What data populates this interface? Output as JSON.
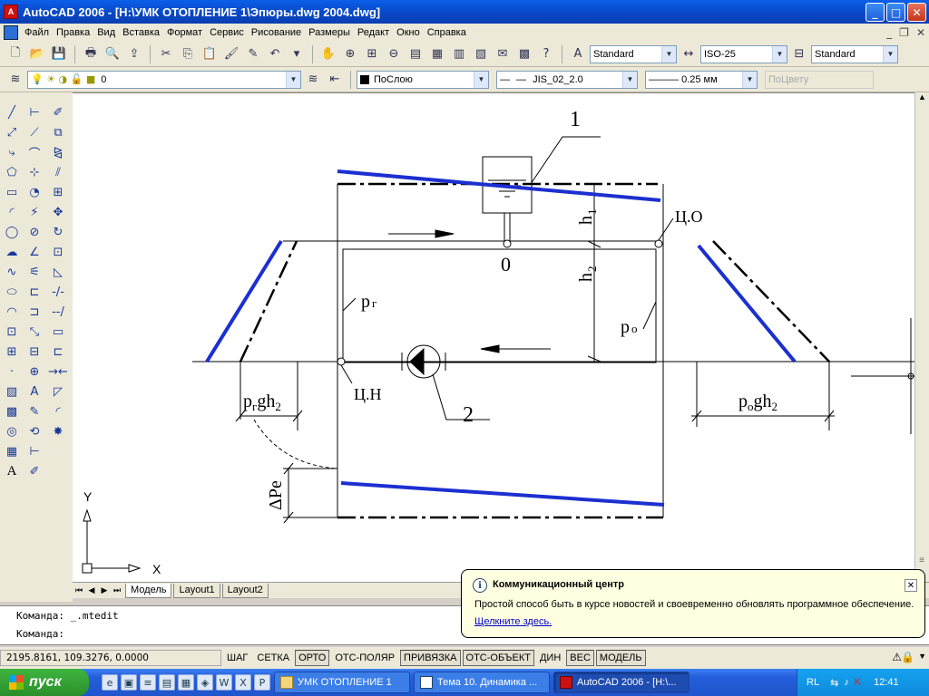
{
  "window": {
    "title": "AutoCAD 2006 - [H:\\УМК ОТОПЛЕНИЕ 1\\Эпюры.dwg 2004.dwg]",
    "min": "_",
    "max": "□",
    "close": "✕"
  },
  "menu": [
    "Файл",
    "Правка",
    "Вид",
    "Вставка",
    "Формат",
    "Сервис",
    "Рисование",
    "Размеры",
    "Редакт",
    "Окно",
    "Справка"
  ],
  "toolbar1": {
    "text_style": "Standard",
    "dim_style": "ISO-25",
    "table_style": "Standard"
  },
  "toolbar2": {
    "layer": "0",
    "color": "ПоСлою",
    "linetype": "JIS_02_2.0",
    "lineweight": "0.25 мм",
    "plotstyle": "ПоЦвету"
  },
  "drawing": {
    "label_1": "1",
    "label_2": "2",
    "label_0": "0",
    "label_co": "Ц.О",
    "label_cn": "Ц.Н",
    "label_h1": "h",
    "label_h1_sub": "1",
    "label_h2": "h",
    "label_h2_sub": "2",
    "label_pr": "p",
    "label_pr_sub": "г",
    "label_po": "p",
    "label_po_sub": "о",
    "label_prgh2_a": "p",
    "label_prgh2_b": "г",
    "label_prgh2_c": "gh",
    "label_prgh2_d": "2",
    "label_pogh2_a": "p",
    "label_pogh2_b": "о",
    "label_pogh2_c": "gh",
    "label_pogh2_d": "2",
    "label_dpe": "ΔPe",
    "axis_y": "Y",
    "axis_x": "X"
  },
  "tabs": [
    "Модель",
    "Layout1",
    "Layout2"
  ],
  "command": {
    "line1": "Команда:  _.mtedit",
    "line2": "Команда:"
  },
  "status": {
    "coords": "2195.8161, 109.3276, 0.0000",
    "buttons": [
      {
        "label": "ШАГ",
        "on": false
      },
      {
        "label": "СЕТКА",
        "on": false
      },
      {
        "label": "ОРТО",
        "on": true
      },
      {
        "label": "ОТС-ПОЛЯР",
        "on": false
      },
      {
        "label": "ПРИВЯЗКА",
        "on": true
      },
      {
        "label": "ОТС-ОБЪЕКТ",
        "on": true
      },
      {
        "label": "ДИН",
        "on": false
      },
      {
        "label": "ВЕС",
        "on": true
      },
      {
        "label": "МОДЕЛЬ",
        "on": true
      }
    ]
  },
  "balloon": {
    "title": "Коммуникационный центр",
    "body": "Простой способ быть в курсе новостей и своевременно обновлять программное обеспечение.",
    "link": "Щелкните здесь."
  },
  "taskbar": {
    "start": "пуск",
    "tasks": [
      "УМК ОТОПЛЕНИЕ 1",
      "Тема 10. Динамика ...",
      "AutoCAD 2006 - [H:\\..."
    ],
    "lang": "RL",
    "time": "12:41"
  },
  "colors": {
    "blue_line": "#1c2fd0",
    "titlebar": "#0a5fe8"
  }
}
